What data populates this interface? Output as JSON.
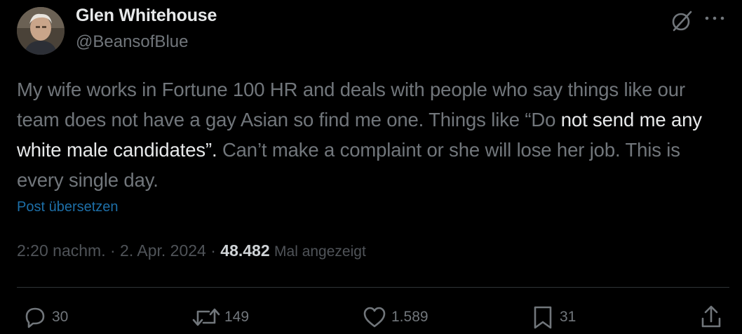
{
  "author": {
    "name": "Glen Whitehouse",
    "handle": "@BeansofBlue",
    "avatar_icon": "profile-photo"
  },
  "header_icons": {
    "grok": "grok-icon",
    "more": "more-dots-icon"
  },
  "tweet": {
    "text_part1": "My wife works in Fortune 100 HR and deals with people who say things like our team does not have a gay Asian so find me one. Things like “Do ",
    "text_highlight": "not send me any white male candidates”.",
    "text_part2": " Can’t make a complaint or she will lose her job. This is every single day.",
    "translate_label": "Post übersetzen"
  },
  "meta": {
    "time": "2:20 nachm.",
    "sep1": " · ",
    "date": "2. Apr. 2024",
    "sep2": " · ",
    "views_count": "48.482",
    "views_label": "Mal angezeigt"
  },
  "actions": {
    "replies": "30",
    "reposts": "149",
    "likes": "1.589",
    "bookmarks": "31"
  },
  "colors": {
    "background": "#000000",
    "primary_text": "#e7e9ea",
    "secondary_text": "#71767b",
    "link": "#1d6fa8",
    "divider": "#2f3336"
  }
}
